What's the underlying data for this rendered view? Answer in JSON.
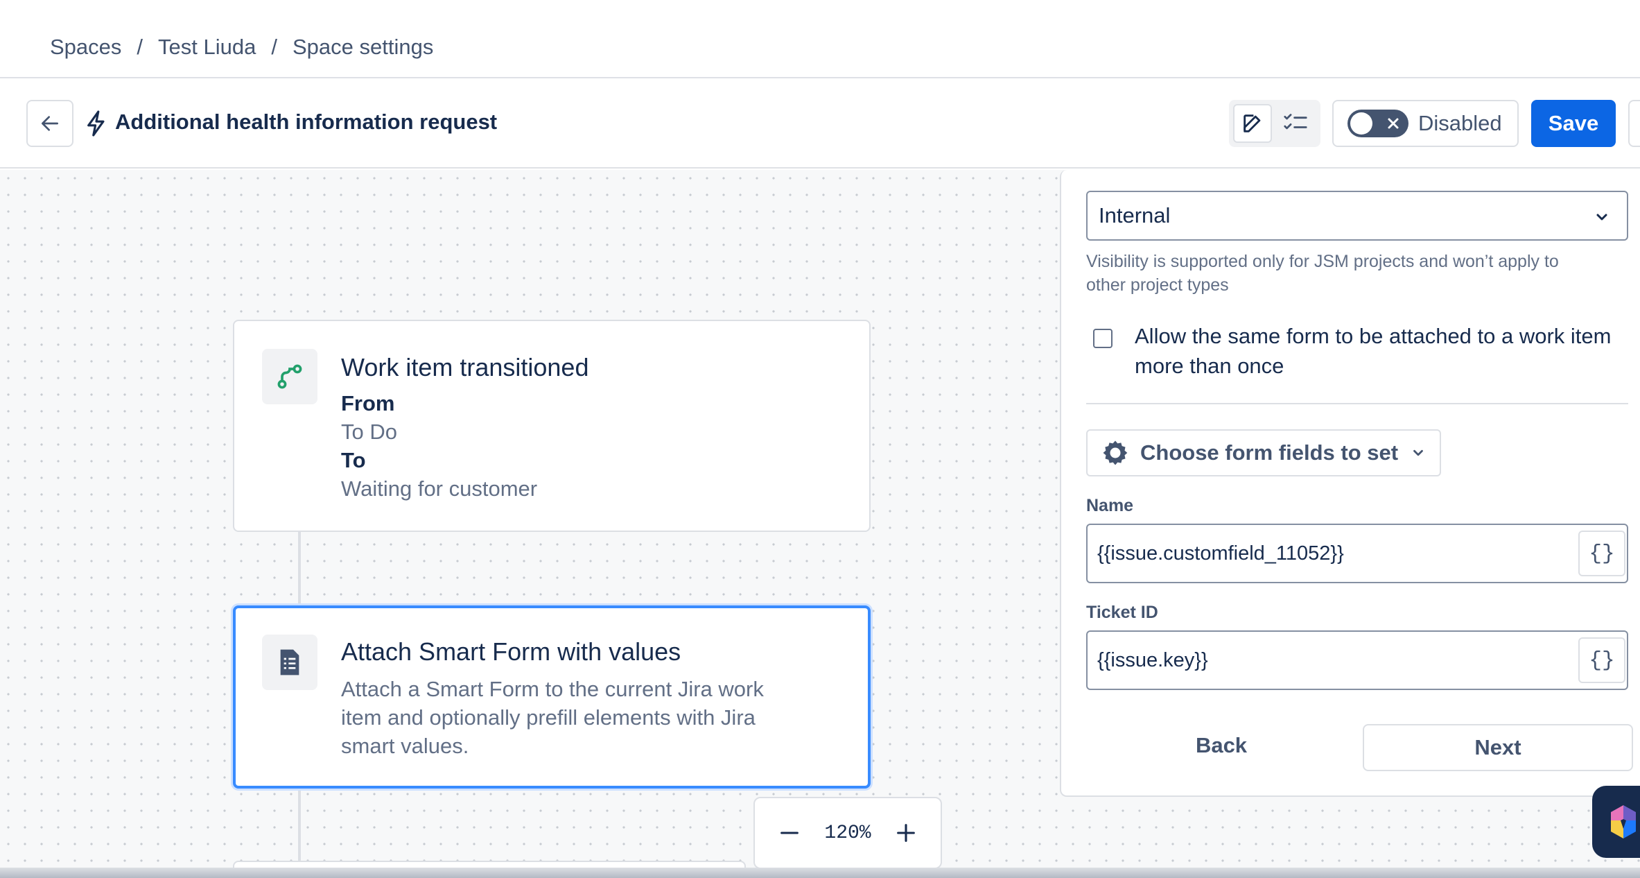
{
  "breadcrumb": {
    "items": [
      "Spaces",
      "Test Liuda",
      "Space settings"
    ],
    "separator": "/"
  },
  "header": {
    "title": "Additional health information request",
    "toggle_label": "Disabled",
    "toggle_state": "off",
    "save_label": "Save",
    "icons": [
      "arrow-left-icon",
      "lightning-bolt-icon",
      "edit-icon",
      "checklist-icon"
    ]
  },
  "canvas": {
    "trigger": {
      "title": "Work item transitioned",
      "from_label": "From",
      "from_value": "To Do",
      "to_label": "To",
      "to_value": "Waiting for customer",
      "icon": "transition-icon"
    },
    "action": {
      "title": "Attach Smart Form with values",
      "description_lines": [
        "Attach a Smart Form to the current Jira work",
        "item and optionally prefill elements with Jira",
        "smart values."
      ],
      "icon": "form-document-icon"
    },
    "zoom": {
      "value": "120%"
    }
  },
  "panel": {
    "visibility": {
      "value": "Internal",
      "helper_lines": [
        "Visibility is supported only for JSM projects and won’t apply to",
        "other project types"
      ]
    },
    "allow_multiple": {
      "label_lines": [
        "Allow the same form to be attached to a work item",
        "more than once"
      ],
      "checked": false
    },
    "fields_button": "Choose form fields to set",
    "fields": [
      {
        "label": "Name",
        "value": "{{issue.customfield_11052}}",
        "smart_glyph": "{}"
      },
      {
        "label": "Ticket ID",
        "value": "{{issue.key}}",
        "smart_glyph": "{}"
      }
    ],
    "back_label": "Back",
    "next_label": "Next"
  },
  "colors": {
    "primary": "#0c66e4",
    "selected_border": "#388bff",
    "text": "#172b4d",
    "subtle_text": "#626f86",
    "trigger_icon": "#22a06b",
    "action_icon": "#44546f"
  }
}
